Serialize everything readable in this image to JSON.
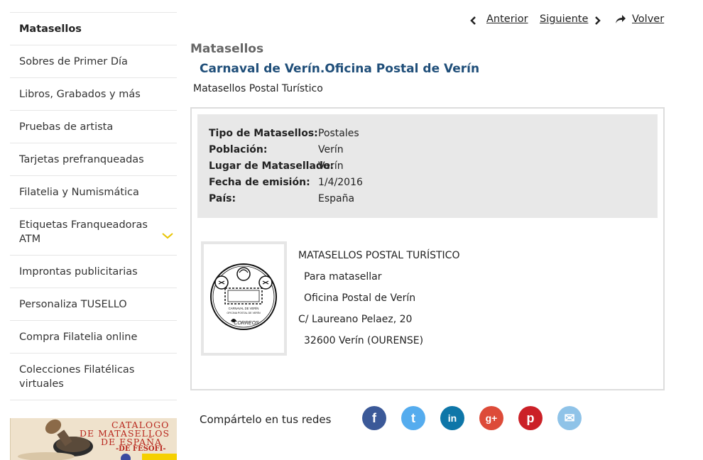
{
  "sidebar": {
    "items": [
      {
        "label": "Matasellos"
      },
      {
        "label": "Sobres de Primer Día"
      },
      {
        "label": "Libros, Grabados y más"
      },
      {
        "label": "Pruebas de artista"
      },
      {
        "label": "Tarjetas prefranqueadas"
      },
      {
        "label": "Filatelia y Numismática"
      },
      {
        "label": "Etiquetas Franqueadoras",
        "label2": "ATM"
      },
      {
        "label": "Improntas publicitarias"
      },
      {
        "label": "Personaliza TUSELLO"
      },
      {
        "label": "Compra Filatelia online"
      },
      {
        "label": "Colecciones Filatélicas",
        "label2": "virtuales"
      }
    ],
    "promo": {
      "line1": "CATALOGO",
      "line2": "DE MATASELLOS",
      "line3": "DE ESPAÑA",
      "line4": "-DE FESOFI-"
    }
  },
  "nav": {
    "prev": "Anterior",
    "next": "Siguiente",
    "back": "Volver"
  },
  "page": {
    "section": "Matasellos",
    "title": "Carnaval de Verín.Oficina Postal de Verín",
    "subtitle": "Matasellos Postal Turístico"
  },
  "details": [
    {
      "key": "Tipo de Matasellos:",
      "value": "Postales"
    },
    {
      "key": "Población:",
      "value": "Verín"
    },
    {
      "key": "Lugar de Matasellado:",
      "value": "Verín"
    },
    {
      "key": "Fecha de emisión:",
      "value": "1/4/2016"
    },
    {
      "key": "País:",
      "value": "España"
    }
  ],
  "postmark": {
    "text1": "CARNAVAL DE VERÍN",
    "text2": "OFICINA POSTAL DE VERÍN",
    "brand": "CORREOS"
  },
  "description": [
    "MATASELLOS POSTAL TURÍSTICO",
    "Para matasellar",
    "Oficina Postal de Verín",
    "C/ Laureano Pelaez, 20",
    "32600 Verín (OURENSE)"
  ],
  "share": {
    "label": "Compártelo en tus redes",
    "networks": [
      {
        "name": "facebook-icon",
        "glyph": "f",
        "color": "#3b5998"
      },
      {
        "name": "twitter-icon",
        "glyph": "t",
        "color": "#55acee"
      },
      {
        "name": "linkedin-icon",
        "glyph": "in",
        "color": "#0e76a8"
      },
      {
        "name": "googleplus-icon",
        "glyph": "g+",
        "color": "#dd4b39"
      },
      {
        "name": "pinterest-icon",
        "glyph": "p",
        "color": "#cb2027"
      },
      {
        "name": "email-icon",
        "glyph": "✉",
        "color": "#8fc3e8"
      }
    ]
  }
}
